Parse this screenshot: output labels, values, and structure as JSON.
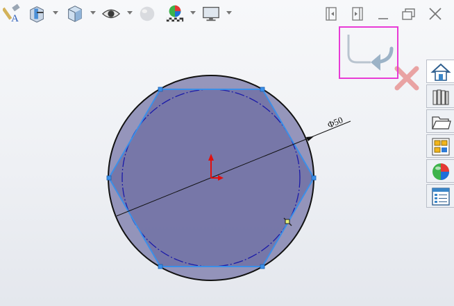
{
  "toolbar": {
    "items": [
      {
        "name": "smart-dimension-icon"
      },
      {
        "name": "section-view-icon"
      },
      {
        "name": "view-orientation-cube-icon"
      },
      {
        "name": "hide-show-eye-icon"
      },
      {
        "name": "edit-appearance-sphere-icon"
      },
      {
        "name": "apply-scene-icon"
      },
      {
        "name": "view-settings-monitor-icon"
      }
    ],
    "window_buttons": [
      "panel-left-icon",
      "panel-right-icon",
      "minimize-icon",
      "restore-icon",
      "close-icon"
    ]
  },
  "confirmation_corner": {
    "accept_icon": "exit-sketch-icon",
    "cancel_icon": "cancel-x-icon",
    "highlight_color": "#e83ad6"
  },
  "sketch": {
    "dimension_label": "Φ50",
    "circle_fill": "#6f6f9e",
    "polygon_color": "#3b8fe8",
    "construction_color": "#1a1aa8",
    "origin_color": "#e01010"
  },
  "task_pane": {
    "tabs": [
      {
        "name": "home-icon",
        "active": true
      },
      {
        "name": "design-library-icon",
        "active": false
      },
      {
        "name": "file-explorer-icon",
        "active": false
      },
      {
        "name": "view-palette-icon",
        "active": false
      },
      {
        "name": "appearances-icon",
        "active": false
      },
      {
        "name": "custom-properties-icon",
        "active": false
      }
    ]
  }
}
